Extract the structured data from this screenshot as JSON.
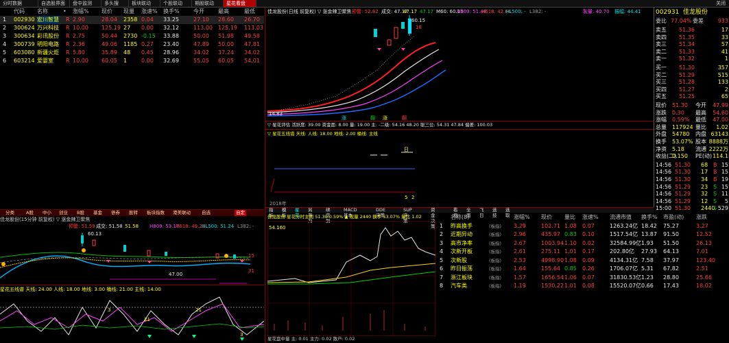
{
  "top_tabs": [
    "分时数据",
    "自选股界面",
    "盘中监测",
    "多头搜",
    "板块联动",
    "个股联动",
    "期股联动",
    "星花看盘"
  ],
  "top_right": "关闭",
  "watchlist": {
    "headers": [
      "",
      "代码",
      "名称",
      "•",
      "涨幅%",
      "现价",
      "现量",
      "涨速%",
      "换手%",
      "今开",
      "最高",
      "最低"
    ],
    "rows": [
      {
        "idx": "1",
        "code": "002930",
        "name": "宏川智慧",
        "tag": "R",
        "chg": "2.90",
        "price": "28.04",
        "vol": "2358",
        "speed": "0.04",
        "turn": "33.25",
        "open": "27.10",
        "high": "28.60",
        "low": "26.70"
      },
      {
        "idx": "2",
        "code": "300624",
        "name": "万兴科技",
        "tag": "R",
        "chg": "10.00",
        "price": "125.19",
        "vol": "27",
        "speed": "0.00",
        "turn": "32.12",
        "open": "113.00",
        "high": "125.19",
        "low": "113.03"
      },
      {
        "idx": "3",
        "code": "300634",
        "name": "彩讯股份",
        "tag": "R",
        "chg": "2.75",
        "price": "50.44",
        "vol": "2730",
        "speed": "-0.15",
        "turn": "33.88",
        "open": "50.00",
        "high": "51.98",
        "low": "49.58"
      },
      {
        "idx": "4",
        "code": "300739",
        "name": "明阳电路",
        "tag": "R",
        "chg": "2.36",
        "price": "49.06",
        "vol": "1185",
        "speed": "0.27",
        "turn": "23.40",
        "open": "47.89",
        "high": "50.00",
        "low": "47.81"
      },
      {
        "idx": "5",
        "code": "603080",
        "name": "新疆火炬",
        "tag": "R",
        "chg": "5.80",
        "price": "35.89",
        "vol": "48",
        "speed": "0.45",
        "turn": "28.96",
        "open": "34.02",
        "high": "37.24",
        "low": "34.02"
      },
      {
        "idx": "6",
        "code": "603214",
        "name": "爱婴室",
        "tag": "R",
        "chg": "10.00",
        "price": "60.05",
        "vol": "1",
        "speed": "0.00",
        "turn": "32.69",
        "open": "55.05",
        "high": "60.05",
        "low": "54.01"
      }
    ]
  },
  "low_tabs": [
    "分类",
    "A股",
    "中小",
    "创业",
    "B股",
    "基金",
    "债券",
    "股转",
    "板块指数",
    "港美联动",
    "自选",
    "自定"
  ],
  "chart_main_title": "佳龙股份(日线 前复权) ▽ 涨金辣卫聚焦",
  "chart_main_vals": [
    "预警: 52.82",
    "成交: 47.17",
    "47.17",
    "47.17",
    "M60: 60.15",
    "H809: 51.48",
    "H618: 42.64",
    "HL500: -",
    "L382: -"
  ],
  "chart_main_right": [
    "製量: 40.70",
    "振幅: 44.41"
  ],
  "chart_main_labels": {
    "top": "60.15",
    "low": "14.83",
    "mark": "18"
  },
  "chart_main_markers": [
    "涨",
    "翻",
    "涨",
    "翻"
  ],
  "ind1_title": "▽ 星花评估  活跃度: 39.00  资金面: 8.00  量: 19.00  主: -二级: 54.16  48.20  聪三位: 54.31  47.84  偏差: 100.03",
  "ind2_title": "▽ 星花五线谱  天线: 人线: 18.00  地线: 2.00  桶线:  主线",
  "ind2_marks": [
    "日",
    "5",
    "2"
  ],
  "year_label": "2018年",
  "mid_tabs": [
    "指标",
    "模板",
    "星花",
    "另存为",
    "绑定到",
    "MACD基本",
    "DDE决策",
    "SUP决策",
    "资金决策",
    "看盘",
    "全面",
    "飞日",
    "选技",
    "选取"
  ],
  "chart_left_title": "佳龙股份(15分钟 前复权) ▽ 涨金辣卫聚焦",
  "chart_left_vals": [
    "预警: 51.59",
    "成交: 51.58",
    "51.58",
    "H809: 53.17",
    "H618: 49.21",
    "HL500: 51.24",
    "L382: -"
  ],
  "chart_left_labels": {
    "top": "60.13",
    "low": "47.00",
    "r1": "15",
    "r2": "31"
  },
  "ind3_title": "星花五线谱  天线: 24.00  人线: 18.00  地线: 3.00  桶线: 21.00  主线: 14.00",
  "ind3_marks": [
    "3",
    "21",
    "21",
    "3"
  ],
  "intraday_title": "佳龙股份  星花分时主图  51.30  0.59%  ▲ 现量 2440  换手 53.07%  量比 1.02",
  "intraday_top": "54.160",
  "intraday_bottom_title": "星花盘中量  主: 0.01  主力: 0.02  散户: 0.02",
  "right_panel": {
    "code": "002931",
    "name": "佳龙股份",
    "ratio_label": "委比",
    "ratio": "77.04%",
    "diff_label": "委差",
    "diff": "933",
    "asks": [
      {
        "label": "卖五",
        "price": "51.36",
        "vol": "17"
      },
      {
        "label": "卖四",
        "price": "51.35",
        "vol": "33"
      },
      {
        "label": "卖三",
        "price": "51.34",
        "vol": "57"
      },
      {
        "label": "卖二",
        "price": "51.33",
        "vol": "41"
      },
      {
        "label": "卖一",
        "price": "51.32",
        "vol": "1"
      }
    ],
    "bids": [
      {
        "label": "买一",
        "price": "51.30",
        "vol": "357"
      },
      {
        "label": "买二",
        "price": "51.29",
        "vol": "515"
      },
      {
        "label": "买三",
        "price": "51.28",
        "vol": "133"
      },
      {
        "label": "买四",
        "price": "51.27",
        "vol": "2"
      },
      {
        "label": "买五",
        "price": "51.25",
        "vol": "65"
      }
    ],
    "stats": [
      {
        "l1": "现价",
        "v1": "51.30",
        "l2": "今开",
        "v2": "47.99"
      },
      {
        "l1": "涨跌",
        "v1": "0.30",
        "l2": "最高",
        "v2": "54.60"
      },
      {
        "l1": "涨幅",
        "v1": "0.59%",
        "l2": "最低",
        "v2": "47.00"
      },
      {
        "l1": "总量",
        "v1": "117924",
        "l2": "量比",
        "v2": "1.02"
      },
      {
        "l1": "外盘",
        "v1": "54780",
        "l2": "内盘",
        "v2": "63143"
      },
      {
        "l1": "换手",
        "v1": "53.07%",
        "l2": "股本",
        "v2": "8888万"
      },
      {
        "l1": "净资",
        "v1": "5.18",
        "l2": "流通",
        "v2": "2222万"
      },
      {
        "l1": "收益(二)",
        "v1": "0.150",
        "l2": "PE(动)",
        "v2": "114.1"
      }
    ],
    "ticks": [
      {
        "t": "14:56",
        "p": "51.30",
        "v": "68",
        "d": "B",
        "n": "15"
      },
      {
        "t": "14:56",
        "p": "51.30",
        "v": "17",
        "d": "B",
        "n": "15"
      },
      {
        "t": "14:56",
        "p": "51.30",
        "v": "34",
        "d": "B",
        "n": "19"
      },
      {
        "t": "14:56",
        "p": "51.29",
        "v": "23",
        "d": "S",
        "n": "15"
      },
      {
        "t": "14:56",
        "p": "51.29",
        "v": "32",
        "d": "S",
        "n": "11"
      },
      {
        "t": "14:56",
        "p": "51.29",
        "v": "12",
        "d": "S",
        "n": "5"
      },
      {
        "t": "15:00",
        "p": "51.30",
        "v": "2440",
        "d": "S",
        "n": "529"
      }
    ]
  },
  "sector_boards": {
    "headers": [
      "",
      "名称(8)",
      "",
      "涨幅%",
      "现价",
      "量比",
      "涨速%",
      "流通市值",
      "换手%",
      "市盈(动)",
      "涨跌"
    ],
    "rows": [
      {
        "idx": "1",
        "name": "昨高换手",
        "tag": "(板指)",
        "chg": "3.29",
        "price": "102.71",
        "ratio": "1.08",
        "speed": "0.07",
        "mcap": "1263.24亿",
        "turn": "18.42",
        "pe": "75.27",
        "diff": "3.27"
      },
      {
        "idx": "2",
        "name": "近期异动",
        "tag": "(板指)",
        "chg": "2.96",
        "price": "435.97",
        "ratio": "0.83",
        "speed": "0.10",
        "mcap": "1517.54亿",
        "turn": "13.87",
        "pe": "91.50",
        "diff": "12.52"
      },
      {
        "idx": "3",
        "name": "高市净率",
        "tag": "(板指)",
        "chg": "2.67",
        "price": "1003.94",
        "ratio": "1.10",
        "speed": "0.02",
        "mcap": "32584.99亿",
        "turn": "1.93",
        "pe": "51.50",
        "diff": "26.13"
      },
      {
        "idx": "4",
        "name": "次新开板",
        "tag": "(板指)",
        "chg": "2.61",
        "price": "275.11",
        "ratio": "1.01",
        "speed": "0.17",
        "mcap": "202.80亿",
        "turn": "27.93",
        "pe": "64.13",
        "diff": "7.01"
      },
      {
        "idx": "5",
        "name": "次新股",
        "tag": "(板指)",
        "chg": "2.53",
        "price": "4998.90",
        "ratio": "1.08",
        "speed": "0.09",
        "mcap": "4134.31亿",
        "turn": "7.58",
        "pe": "37.97",
        "diff": "123.40"
      },
      {
        "idx": "6",
        "name": "昨日振荡",
        "tag": "(板指)",
        "chg": "1.64",
        "price": "155.64",
        "ratio": "0.85",
        "speed": "0.26",
        "mcap": "1706.07亿",
        "turn": "5.31",
        "pe": "67.82",
        "diff": "2.51"
      },
      {
        "idx": "7",
        "name": "浙江板块",
        "tag": "(板指)",
        "chg": "1.57",
        "price": "1656.54",
        "ratio": "1.06",
        "speed": "0.07",
        "mcap": "31830.53亿",
        "turn": "1.23",
        "pe": "28.80",
        "diff": "25.66"
      },
      {
        "idx": "8",
        "name": "汽车类",
        "tag": "(板指)",
        "chg": "1.19",
        "price": "1530.22",
        "ratio": "1.01",
        "speed": "0.08",
        "mcap": "15520.07亿",
        "turn": "0.66",
        "pe": "17.43",
        "diff": "18.02"
      }
    ]
  },
  "colors": {
    "up": "#ff3b3b",
    "down": "#00d000",
    "accent": "#b00000",
    "highlight": "#ffff00"
  }
}
